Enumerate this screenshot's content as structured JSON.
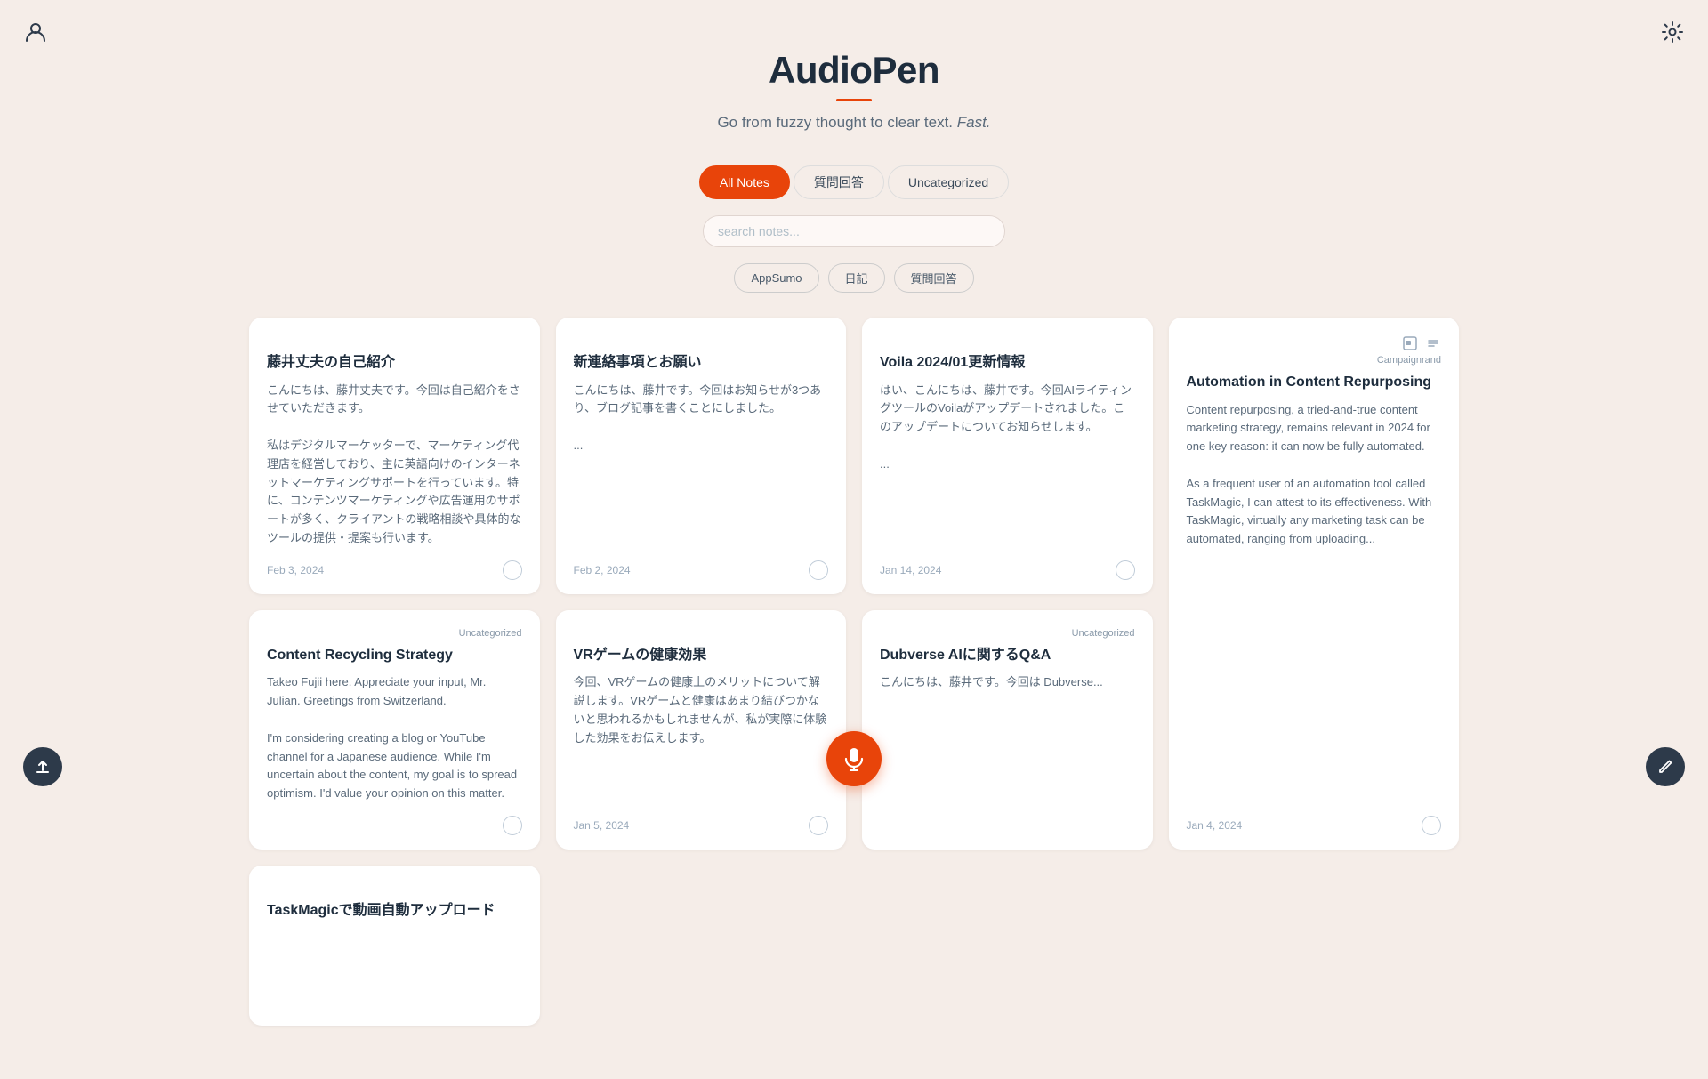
{
  "app": {
    "title": "AudioPen",
    "subtitle_plain": "Go from fuzzy thought to clear text.",
    "subtitle_italic": "Fast.",
    "underline_color": "#e8440a"
  },
  "tabs": [
    {
      "id": "all",
      "label": "All Notes",
      "active": true
    },
    {
      "id": "qa",
      "label": "質問回答",
      "active": false
    },
    {
      "id": "uncategorized",
      "label": "Uncategorized",
      "active": false
    }
  ],
  "search": {
    "placeholder": "search notes..."
  },
  "filters": [
    {
      "id": "appsumo",
      "label": "AppSumo"
    },
    {
      "id": "diary",
      "label": "日記"
    },
    {
      "id": "qa",
      "label": "質問回答"
    }
  ],
  "notes": [
    {
      "id": 1,
      "badge": "",
      "title": "藤井丈夫の自己紹介",
      "body": "こんにちは、藤井丈夫です。今回は自己紹介をさせていただきます。\n\n私はデジタルマーケッターで、マーケティング代理店を経営しており、主に英語向けのインターネットマーケティングサポートを行っています。特に、コンテンツマーケティングや広告運用のサポートが多く、クライアントの戦略相談や具体的なツールの提供・提案も行います。",
      "date": "Feb 3, 2024",
      "tall": false
    },
    {
      "id": 2,
      "badge": "",
      "title": "新連絡事項とお願い",
      "body": "こんにちは、藤井です。今回はお知らせが3つあり、ブログ記事を書くことにしました。\n\n...",
      "date": "Feb 2, 2024",
      "tall": false
    },
    {
      "id": 3,
      "badge": "",
      "title": "Voila 2024/01更新情報",
      "body": "はい、こんにちは、藤井です。今回AIライティングツールのVoilaがアップデートされました。このアップデートについてお知らせします。\n\n...",
      "date": "Jan 14, 2024",
      "tall": false
    },
    {
      "id": 4,
      "badge": "Campaignrand",
      "title": "Automation in Content Repurposing",
      "body": "Content repurposing, a tried-and-true content marketing strategy, remains relevant in 2024 for one key reason: it can now be fully automated.\n\nAs a frequent user of an automation tool called TaskMagic, I can attest to its effectiveness. With TaskMagic, virtually any marketing task can be automated, ranging from uploading...",
      "date": "Jan 4, 2024",
      "tall": true
    },
    {
      "id": 5,
      "badge": "Uncategorized",
      "title": "Content Recycling Strategy",
      "body": "Takeo Fujii here. Appreciate your input, Mr. Julian. Greetings from Switzerland.\n\nI'm considering creating a blog or YouTube channel for a Japanese audience. While I'm uncertain about the content, my goal is to spread optimism. I'd value your opinion on this matter.",
      "date": "",
      "tall": false
    },
    {
      "id": 6,
      "badge": "",
      "title": "VRゲームの健康効果",
      "body": "今回、VRゲームの健康上のメリットについて解説します。VRゲームと健康はあまり結びつかないと思われるかもしれませんが、私が実際に体験した効果をお伝えします。",
      "date": "Jan 5, 2024",
      "tall": false
    },
    {
      "id": 7,
      "badge": "Uncategorized",
      "title": "Dubverse AIに関するQ&A",
      "body": "こんにちは、藤井です。今回は Dubverse...",
      "date": "",
      "tall": false
    },
    {
      "id": 8,
      "badge": "",
      "title": "TaskMagicで動画自動アップロード",
      "body": "",
      "date": "",
      "tall": false
    }
  ],
  "icons": {
    "user": "👤",
    "settings": "⚙",
    "mic": "🎤",
    "upload": "↑",
    "edit": "✎",
    "image": "🖼",
    "list": "≡"
  },
  "colors": {
    "accent": "#e8440a",
    "dark": "#1e2d3d",
    "bg": "#f5ede8"
  }
}
